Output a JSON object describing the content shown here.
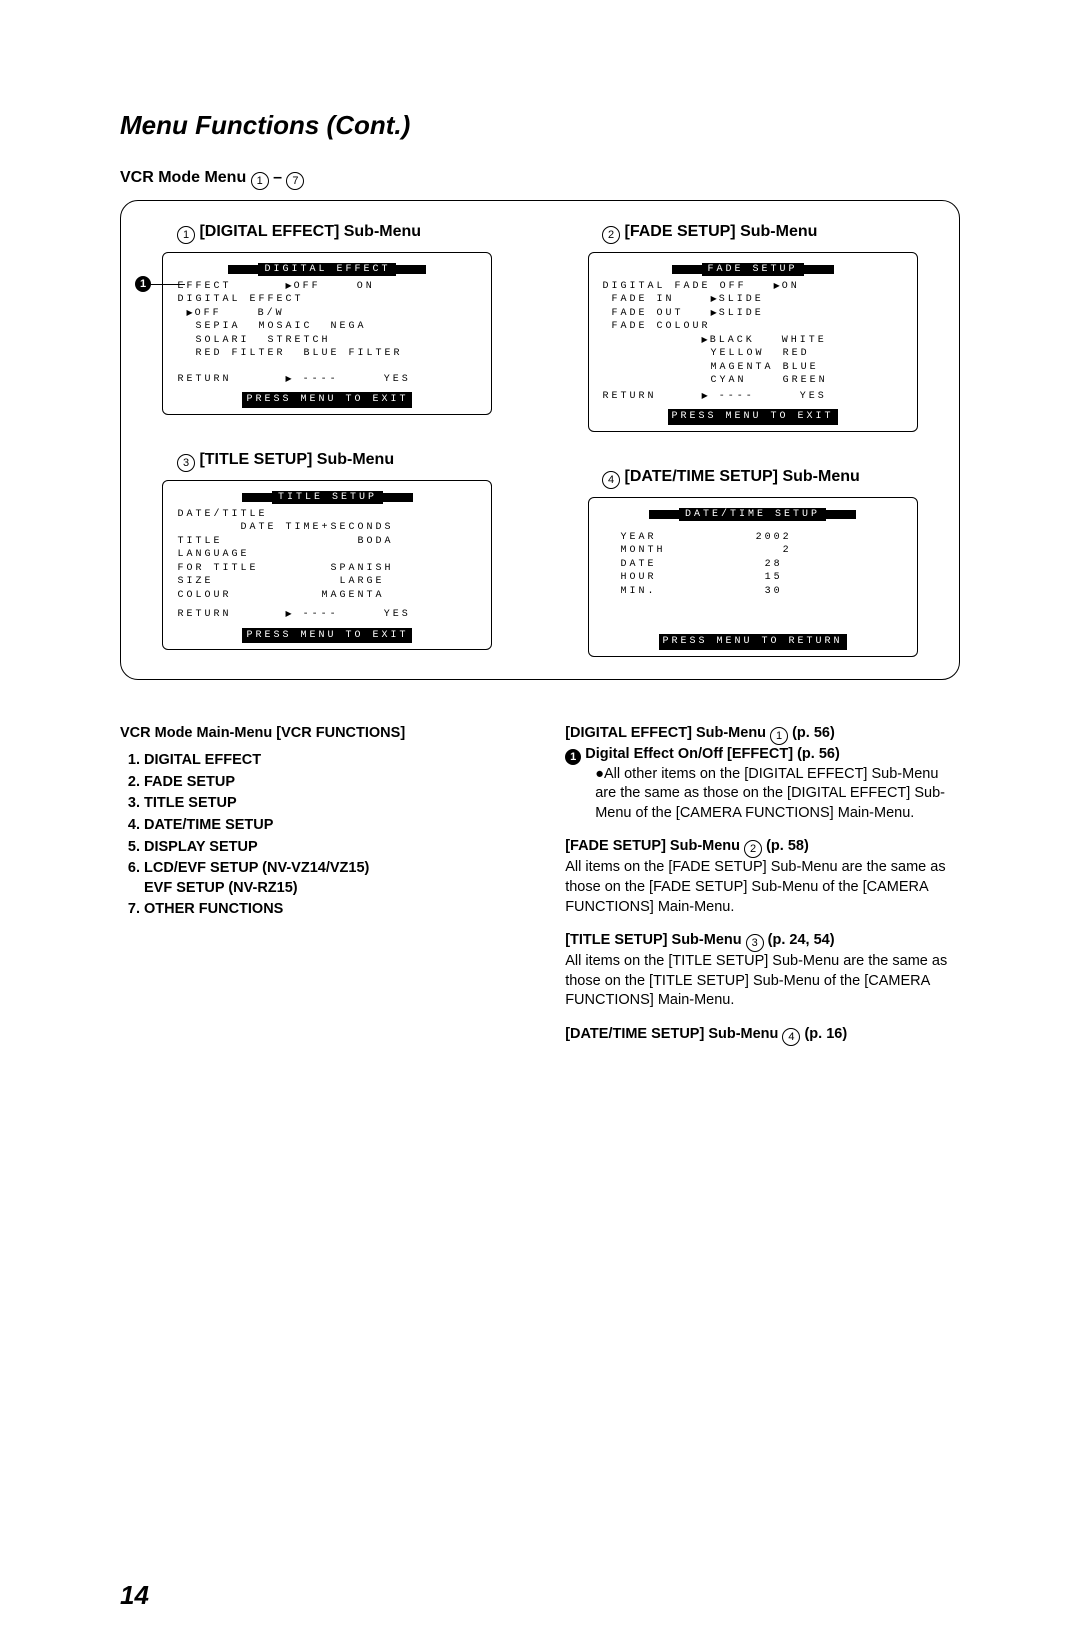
{
  "title": "Menu Functions (Cont.)",
  "vcr_mode_label": "VCR Mode Menu",
  "range_sep": "–",
  "submenus": {
    "s1": {
      "num": "1",
      "title": "[DIGITAL EFFECT] Sub-Menu"
    },
    "s2": {
      "num": "2",
      "title": "[FADE SETUP] Sub-Menu"
    },
    "s3": {
      "num": "3",
      "title": "[TITLE SETUP] Sub-Menu"
    },
    "s4": {
      "num": "4",
      "title": "[DATE/TIME SETUP] Sub-Menu"
    }
  },
  "screen1": {
    "header": "DIGITAL EFFECT",
    "r1a": "EFFECT",
    "r1b": "OFF",
    "r1c": "ON",
    "r2": "DIGITAL EFFECT",
    "r3a": "OFF",
    "r3b": "B/W",
    "r4a": "SEPIA",
    "r4b": "MOSAIC",
    "r4c": "NEGA",
    "r5a": "SOLARI",
    "r5b": "STRETCH",
    "r6a": "RED FILTER",
    "r6b": "BLUE FILTER",
    "ret": "RETURN",
    "dashes": "----",
    "yes": "YES",
    "press": "PRESS MENU TO EXIT"
  },
  "screen2": {
    "header": "FADE SETUP",
    "r1a": "DIGITAL FADE",
    "r1b": "OFF",
    "r1c": "ON",
    "r2a": "FADE IN",
    "r2b": "SLIDE",
    "r3a": "FADE OUT",
    "r3b": "SLIDE",
    "r4": "FADE COLOUR",
    "c1a": "BLACK",
    "c1b": "WHITE",
    "c2a": "YELLOW",
    "c2b": "RED",
    "c3a": "MAGENTA",
    "c3b": "BLUE",
    "c4a": "CYAN",
    "c4b": "GREEN",
    "ret": "RETURN",
    "dashes": "----",
    "yes": "YES",
    "press": "PRESS MENU TO EXIT"
  },
  "screen3": {
    "header": "TITLE SETUP",
    "r1": "DATE/TITLE",
    "r2": "DATE TIME+SECONDS",
    "r3a": "TITLE",
    "r3b": "BODA",
    "r4": "LANGUAGE",
    "r5a": "FOR TITLE",
    "r5b": "SPANISH",
    "r6a": "SIZE",
    "r6b": "LARGE",
    "r7a": "COLOUR",
    "r7b": "MAGENTA",
    "ret": "RETURN",
    "dashes": "----",
    "yes": "YES",
    "press": "PRESS MENU TO EXIT"
  },
  "screen4": {
    "header": "DATE/TIME SETUP",
    "r1a": "YEAR",
    "r1b": "2002",
    "r2a": "MONTH",
    "r2b": "2",
    "r3a": "DATE",
    "r3b": "28",
    "r4a": "HOUR",
    "r4b": "15",
    "r5a": "MIN.",
    "r5b": "30",
    "press": "PRESS MENU TO RETURN"
  },
  "left_block": {
    "heading": "VCR Mode Main-Menu [VCR FUNCTIONS]",
    "items": [
      "DIGITAL EFFECT",
      "FADE SETUP",
      "TITLE SETUP",
      "DATE/TIME SETUP",
      "DISPLAY SETUP",
      "LCD/EVF SETUP (NV-VZ14/VZ15)",
      "OTHER FUNCTIONS"
    ],
    "item6b": "EVF SETUP (NV-RZ15)"
  },
  "right_block": {
    "h1": "[DIGITAL EFFECT] Sub-Menu",
    "h1p": "(p. 56)",
    "b1": "Digital Effect On/Off [EFFECT] (p. 56)",
    "b1t": "All other items on the [DIGITAL EFFECT] Sub-Menu are the same as those on the [DIGITAL EFFECT] Sub-Menu of the [CAMERA FUNCTIONS] Main-Menu.",
    "h2": "[FADE SETUP] Sub-Menu",
    "h2p": "(p. 58)",
    "h2t": "All items on the [FADE SETUP] Sub-Menu are the same as those on the [FADE SETUP] Sub-Menu of the [CAMERA FUNCTIONS] Main-Menu.",
    "h3": "[TITLE SETUP] Sub-Menu",
    "h3p": "(p. 24, 54)",
    "h3t": "All items on the [TITLE SETUP] Sub-Menu are the same as those on the [TITLE SETUP] Sub-Menu of the [CAMERA FUNCTIONS] Main-Menu.",
    "h4": "[DATE/TIME SETUP] Sub-Menu",
    "h4p": "(p. 16)"
  },
  "pagenum": "14"
}
